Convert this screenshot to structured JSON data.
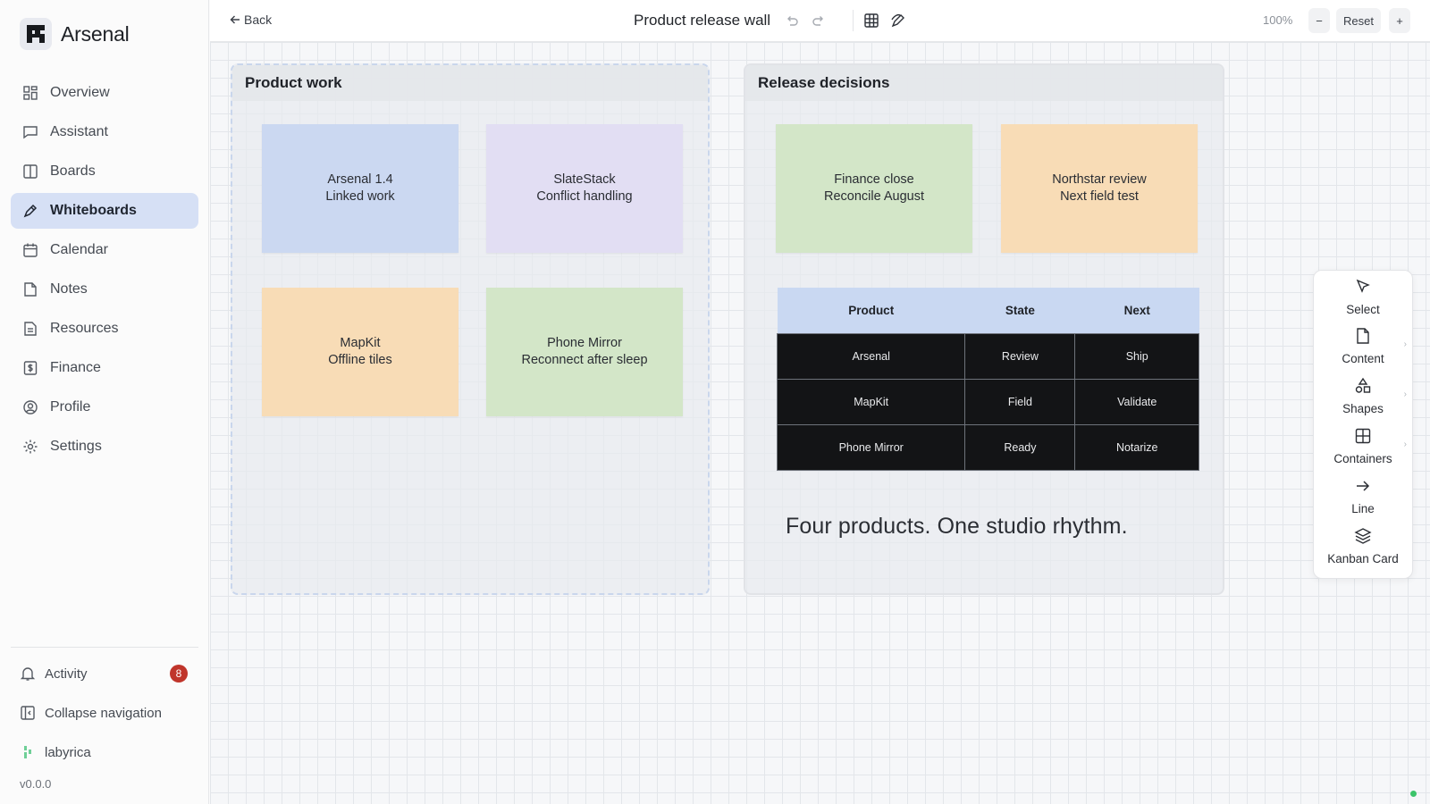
{
  "app": {
    "name": "Arsenal",
    "version": "v0.0.0"
  },
  "sidebar": {
    "items": [
      {
        "label": "Overview",
        "icon": "grid-icon"
      },
      {
        "label": "Assistant",
        "icon": "chat-icon"
      },
      {
        "label": "Boards",
        "icon": "columns-icon"
      },
      {
        "label": "Whiteboards",
        "icon": "pen-icon",
        "active": true
      },
      {
        "label": "Calendar",
        "icon": "calendar-icon"
      },
      {
        "label": "Notes",
        "icon": "note-icon"
      },
      {
        "label": "Resources",
        "icon": "document-icon"
      },
      {
        "label": "Finance",
        "icon": "dollar-icon"
      },
      {
        "label": "Profile",
        "icon": "user-icon"
      },
      {
        "label": "Settings",
        "icon": "gear-icon"
      }
    ],
    "activity": {
      "label": "Activity",
      "count": "8"
    },
    "collapse_label": "Collapse navigation",
    "workspace": "labyrica"
  },
  "toolbar": {
    "back_label": "Back",
    "title": "Product release wall",
    "zoom": "100%",
    "zoom_out": "−",
    "reset": "Reset",
    "zoom_in": "+"
  },
  "board": {
    "containers": [
      {
        "title": "Product work",
        "notes": [
          {
            "line1": "Arsenal 1.4",
            "line2": "Linked work",
            "color": "#cbd8f1"
          },
          {
            "line1": "SlateStack",
            "line2": "Conflict handling",
            "color": "#e2def3"
          },
          {
            "line1": "MapKit",
            "line2": "Offline tiles",
            "color": "#f8dcb6"
          },
          {
            "line1": "Phone Mirror",
            "line2": "Reconnect after sleep",
            "color": "#d3e6c8"
          }
        ]
      },
      {
        "title": "Release decisions",
        "notes": [
          {
            "line1": "Finance close",
            "line2": "Reconcile August",
            "color": "#d3e6c8"
          },
          {
            "line1": "Northstar review",
            "line2": "Next field test",
            "color": "#f8dcb6"
          }
        ],
        "table": {
          "headers": [
            "Product",
            "State",
            "Next"
          ],
          "rows": [
            [
              "Arsenal",
              "Review",
              "Ship"
            ],
            [
              "MapKit",
              "Field",
              "Validate"
            ],
            [
              "Phone Mirror",
              "Ready",
              "Notarize"
            ]
          ]
        },
        "text": "Four products. One studio rhythm."
      }
    ]
  },
  "tools": [
    {
      "label": "Select",
      "icon": "cursor-icon"
    },
    {
      "label": "Content",
      "icon": "file-icon",
      "submenu": true
    },
    {
      "label": "Shapes",
      "icon": "shapes-icon",
      "submenu": true
    },
    {
      "label": "Containers",
      "icon": "frame-icon",
      "submenu": true
    },
    {
      "label": "Line",
      "icon": "arrow-right-icon"
    },
    {
      "label": "Kanban Card",
      "icon": "layers-icon"
    }
  ],
  "colors": {
    "accent": "#d6e0f5",
    "badge": "#c0352b",
    "status": "#3cc46a"
  }
}
